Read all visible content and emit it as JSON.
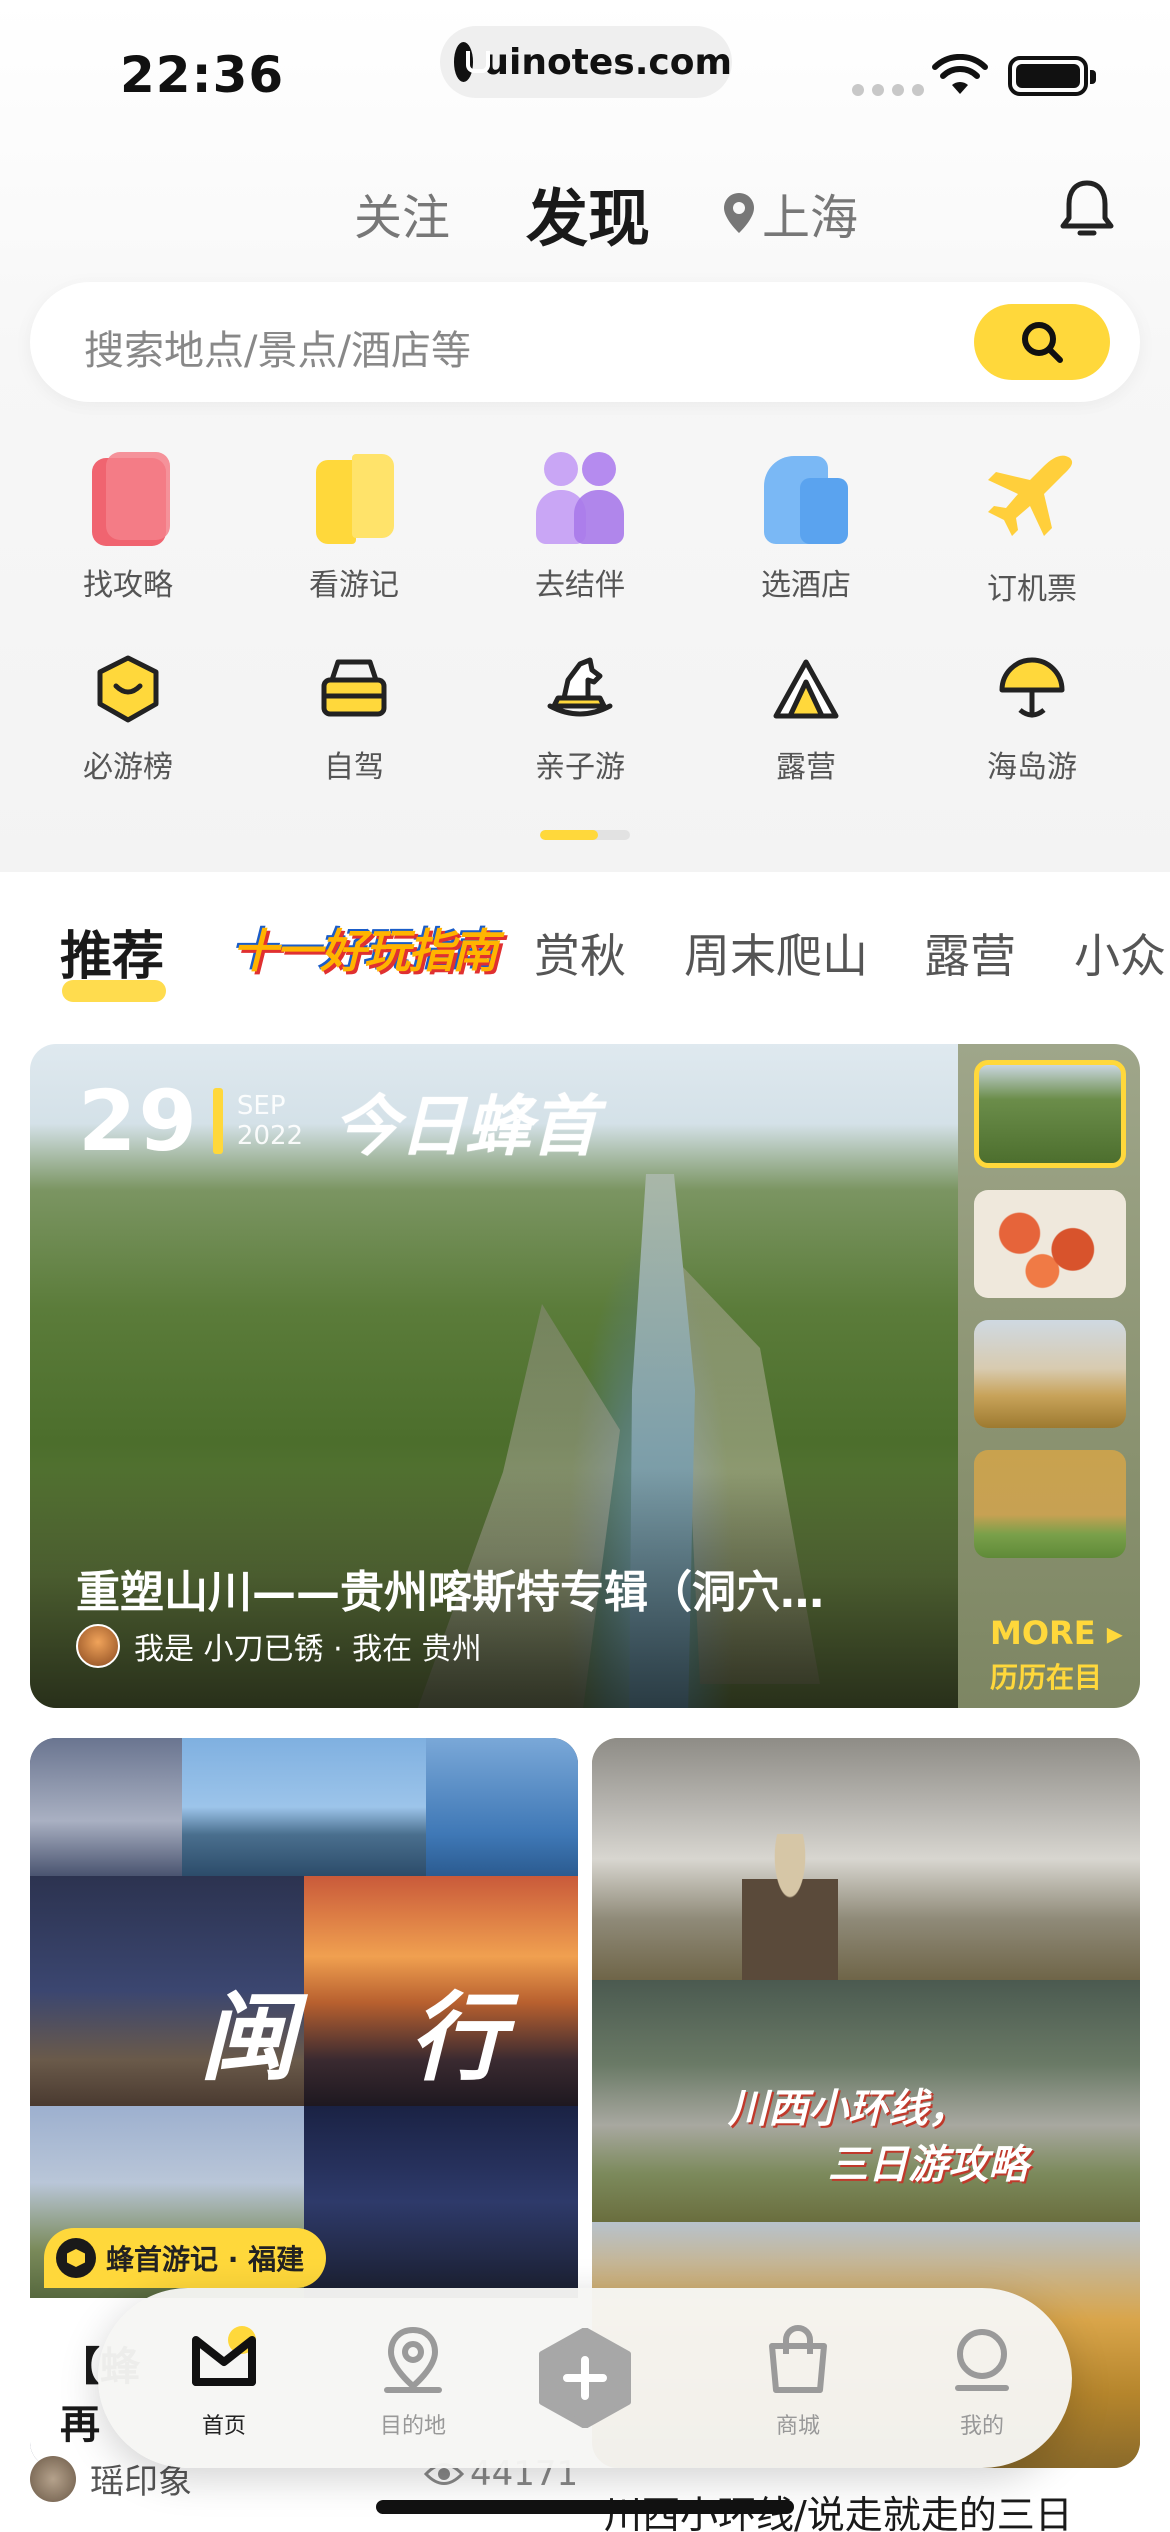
{
  "status_bar": {
    "time": "22:36",
    "url": "uinotes.com"
  },
  "header": {
    "tabs": [
      "关注",
      "发现"
    ],
    "location": "上海"
  },
  "search": {
    "placeholder": "搜索地点/景点/酒店等"
  },
  "quick_grid": [
    {
      "label": "找攻略",
      "icon": "guide-icon"
    },
    {
      "label": "看游记",
      "icon": "travelogue-icon"
    },
    {
      "label": "去结伴",
      "icon": "companion-icon"
    },
    {
      "label": "选酒店",
      "icon": "hotel-icon"
    },
    {
      "label": "订机票",
      "icon": "plane-icon"
    },
    {
      "label": "必游榜",
      "icon": "ranking-icon"
    },
    {
      "label": "自驾",
      "icon": "car-icon"
    },
    {
      "label": "亲子游",
      "icon": "rocking-horse-icon"
    },
    {
      "label": "露营",
      "icon": "tent-icon"
    },
    {
      "label": "海岛游",
      "icon": "umbrella-icon"
    }
  ],
  "categories": [
    "推荐",
    "十一好玩指南",
    "赏秋",
    "周末爬山",
    "露营",
    "小众"
  ],
  "hero": {
    "day": "29",
    "month": "SEP",
    "year": "2022",
    "brand": "今日蜂首",
    "title": "重塑山川——贵州喀斯特专辑（洞穴…",
    "author": "我是 小刀已锈 · 我在 贵州",
    "more": "MORE",
    "more_sub": "历历在目"
  },
  "feed": {
    "left": {
      "overlay_text": "闽 行",
      "badge": "蜂首游记 · 福建",
      "title_line1": "【蜂",
      "title_line2": "再",
      "author": "瑶印象",
      "views": "44171"
    },
    "right": {
      "overlay_line1": "川西小环线，",
      "overlay_line2": "三日游攻略",
      "title": "川西小环线/说走就走的三日"
    }
  },
  "tabbar": [
    {
      "label": "首页",
      "icon": "home-icon"
    },
    {
      "label": "目的地",
      "icon": "destination-icon"
    },
    {
      "label": "",
      "icon": "plus-icon"
    },
    {
      "label": "商城",
      "icon": "shop-bag-icon"
    },
    {
      "label": "我的",
      "icon": "profile-icon"
    }
  ],
  "colors": {
    "accent": "#ffd83b",
    "text": "#1a1a1a",
    "muted": "#777777"
  }
}
